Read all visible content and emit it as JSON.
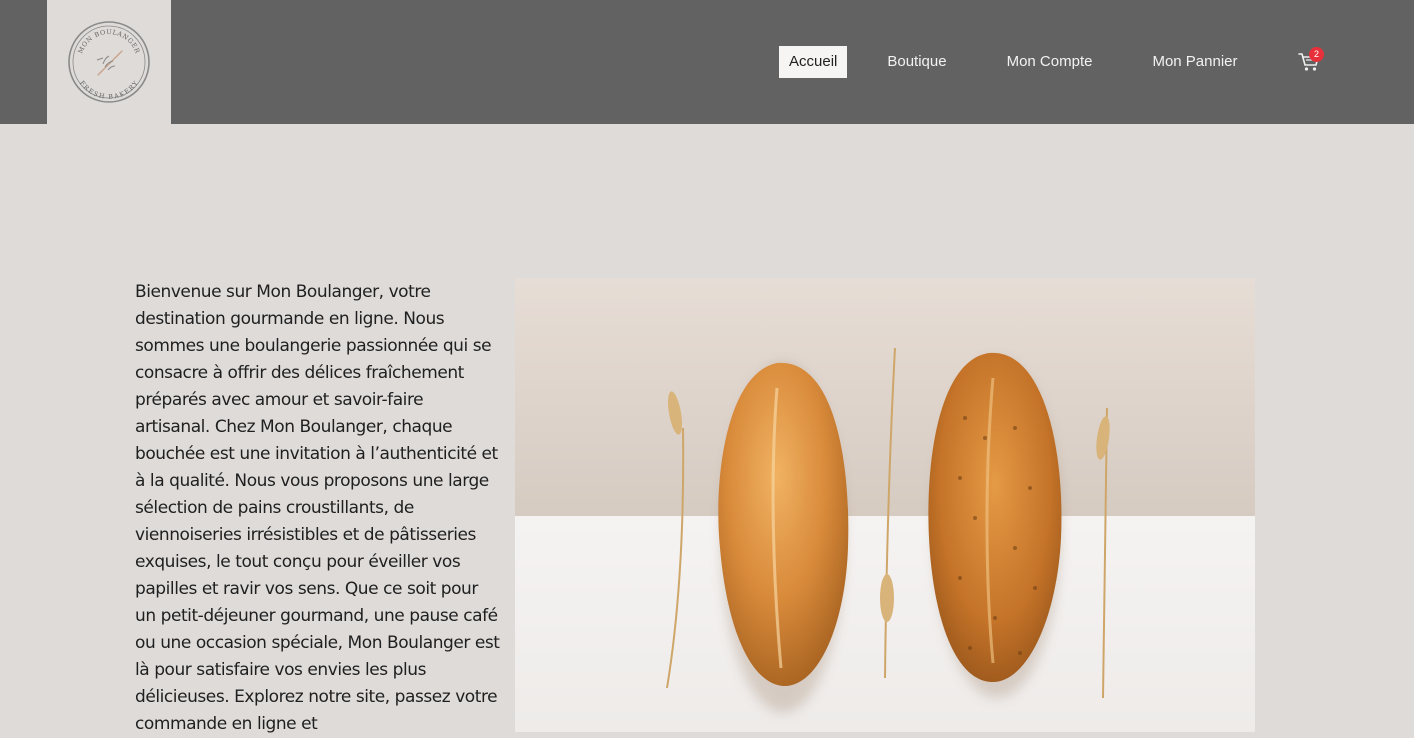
{
  "header": {
    "logo": {
      "line1": "MON BOULANGER",
      "line2": "FRESH BAKERY"
    },
    "nav": [
      {
        "label": "Accueil",
        "active": true
      },
      {
        "label": "Boutique",
        "active": false
      },
      {
        "label": "Mon Compte",
        "active": false
      },
      {
        "label": "Mon Pannier",
        "active": false
      }
    ],
    "cart": {
      "icon": "cart-icon",
      "count": "2"
    }
  },
  "main": {
    "intro_text": "Bienvenue sur Mon Boulanger, votre destination gourmande en ligne. Nous sommes une boulangerie passionnée qui se consacre à offrir des délices fraîchement préparés avec amour et savoir-faire artisanal. Chez Mon Boulanger, chaque bouchée est une invitation à l’authenticité et à la qualité. Nous vous proposons une large sélection de pains croustillants, de viennoiseries irrésistibles et de pâtisseries exquises, le tout conçu pour éveiller vos papilles et ravir vos sens. Que ce soit pour un petit-déjeuner gourmand, une pause café ou une occasion spéciale, Mon Boulanger est là pour satisfaire vos envies les plus délicieuses. Explorez notre site, passez votre commande en ligne et"
  },
  "colors": {
    "header_bg": "#626262",
    "page_bg": "#dedbd9",
    "active_nav_bg": "#f7f5f3",
    "badge": "#e8303a"
  }
}
